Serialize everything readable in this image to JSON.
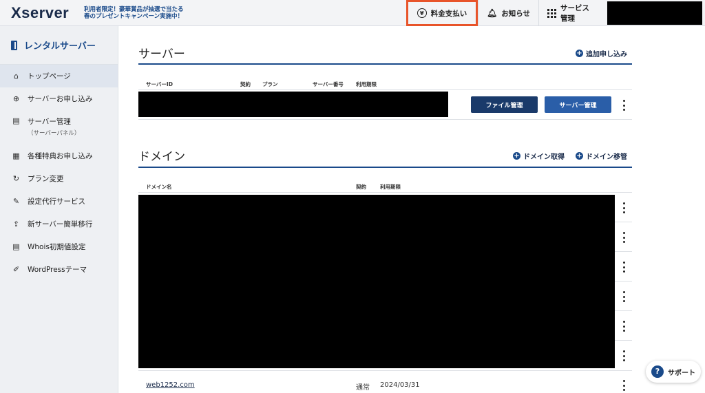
{
  "header": {
    "logo": "Xserver",
    "promo_line1": "利用者限定！豪華賞品が抽選で当たる",
    "promo_line2": "春のプレゼントキャンペーン実施中！",
    "pay_label": "料金支払い",
    "news_label": "お知らせ",
    "services_label": "サービス管理",
    "yen_symbol": "¥"
  },
  "sidebar": {
    "title": "レンタルサーバー",
    "items": [
      {
        "label": "トップページ",
        "icon": "home-icon",
        "glyph": "⌂"
      },
      {
        "label": "サーバーお申し込み",
        "icon": "plus-circle-icon",
        "glyph": "⊕"
      },
      {
        "label": "サーバー管理",
        "sub": "（サーバーパネル）",
        "icon": "server-icon",
        "glyph": "▤"
      },
      {
        "label": "各種特典お申し込み",
        "icon": "gift-icon",
        "glyph": "▦"
      },
      {
        "label": "プラン変更",
        "icon": "refresh-icon",
        "glyph": "↻"
      },
      {
        "label": "設定代行サービス",
        "icon": "wrench-icon",
        "glyph": "✎"
      },
      {
        "label": "新サーバー簡単移行",
        "icon": "upload-icon",
        "glyph": "⇪"
      },
      {
        "label": "Whois初期値設定",
        "icon": "document-icon",
        "glyph": "▤"
      },
      {
        "label": "WordPressテーマ",
        "icon": "edit-icon",
        "glyph": "✐"
      }
    ]
  },
  "server_section": {
    "title": "サーバー",
    "add_label": "追加申し込み",
    "columns": [
      "サーバーID",
      "契約",
      "プラン",
      "サーバー番号",
      "利用期限"
    ],
    "file_button": "ファイル管理",
    "manage_button": "サーバー管理"
  },
  "domain_section": {
    "title": "ドメイン",
    "acquire_label": "ドメイン取得",
    "transfer_label": "ドメイン移管",
    "columns": [
      "ドメイン名",
      "契約",
      "利用期限"
    ],
    "row": {
      "name": "web1252.com",
      "contract": "通常",
      "expiry": "2024/03/31"
    }
  },
  "support_label": "サポート",
  "colors": {
    "accent": "#1a4a8a",
    "highlight": "#e8542a",
    "button_dark": "#1a3a6a",
    "button_mid": "#2a5ea8"
  }
}
